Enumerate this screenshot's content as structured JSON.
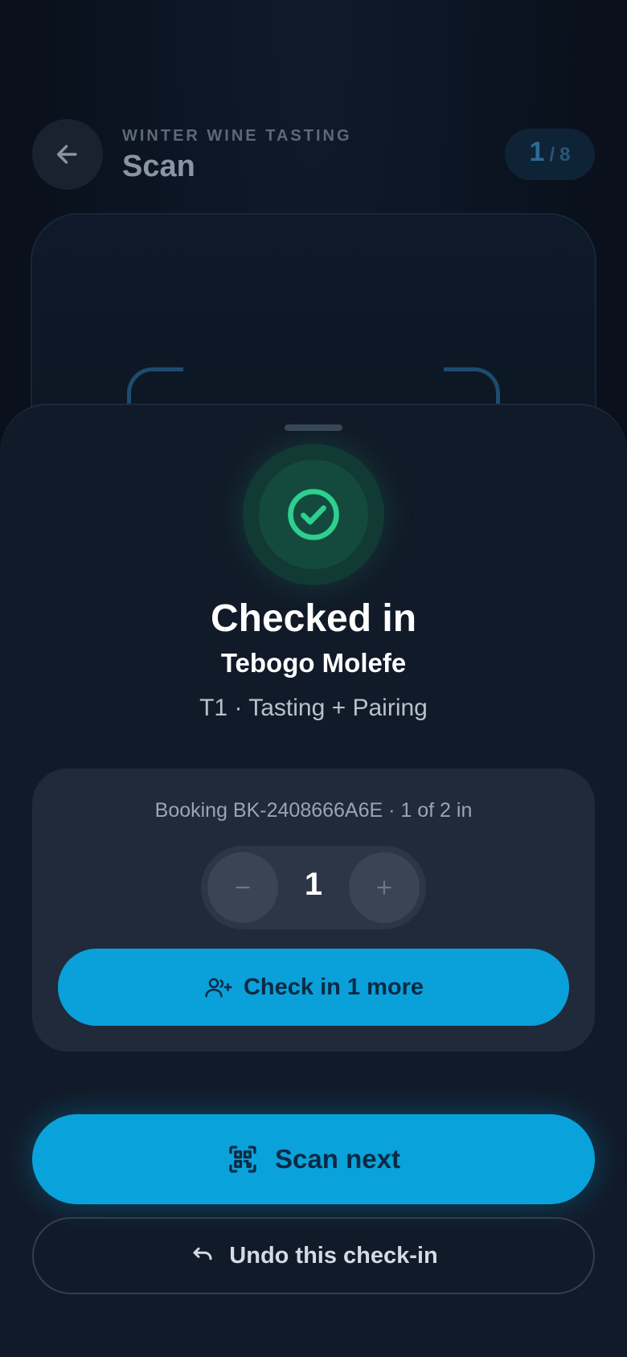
{
  "header": {
    "eyebrow": "WINTER WINE TASTING",
    "title": "Scan",
    "counter": {
      "current": "1",
      "separator": "/",
      "total": "8"
    }
  },
  "result": {
    "status": "Checked in",
    "guest_name": "Tebogo Molefe",
    "ticket": "T1 · Tasting + Pairing"
  },
  "booking": {
    "summary": "Booking BK-2408666A6E · 1 of 2 in",
    "quantity": "1",
    "minus_symbol": "−",
    "plus_symbol": "+",
    "check_in_more_label": "Check in 1 more"
  },
  "actions": {
    "scan_next_label": "Scan next",
    "undo_label": "Undo this check-in"
  },
  "icons": {
    "back": "arrow-left-icon",
    "success": "check-circle-icon",
    "add_user": "user-plus-icon",
    "qr": "qr-code-icon",
    "undo": "undo-arrow-icon"
  },
  "colors": {
    "accent": "#0aa2db",
    "success": "#2fcf8f",
    "sheet": "#111a28",
    "card": "#202a3a"
  }
}
